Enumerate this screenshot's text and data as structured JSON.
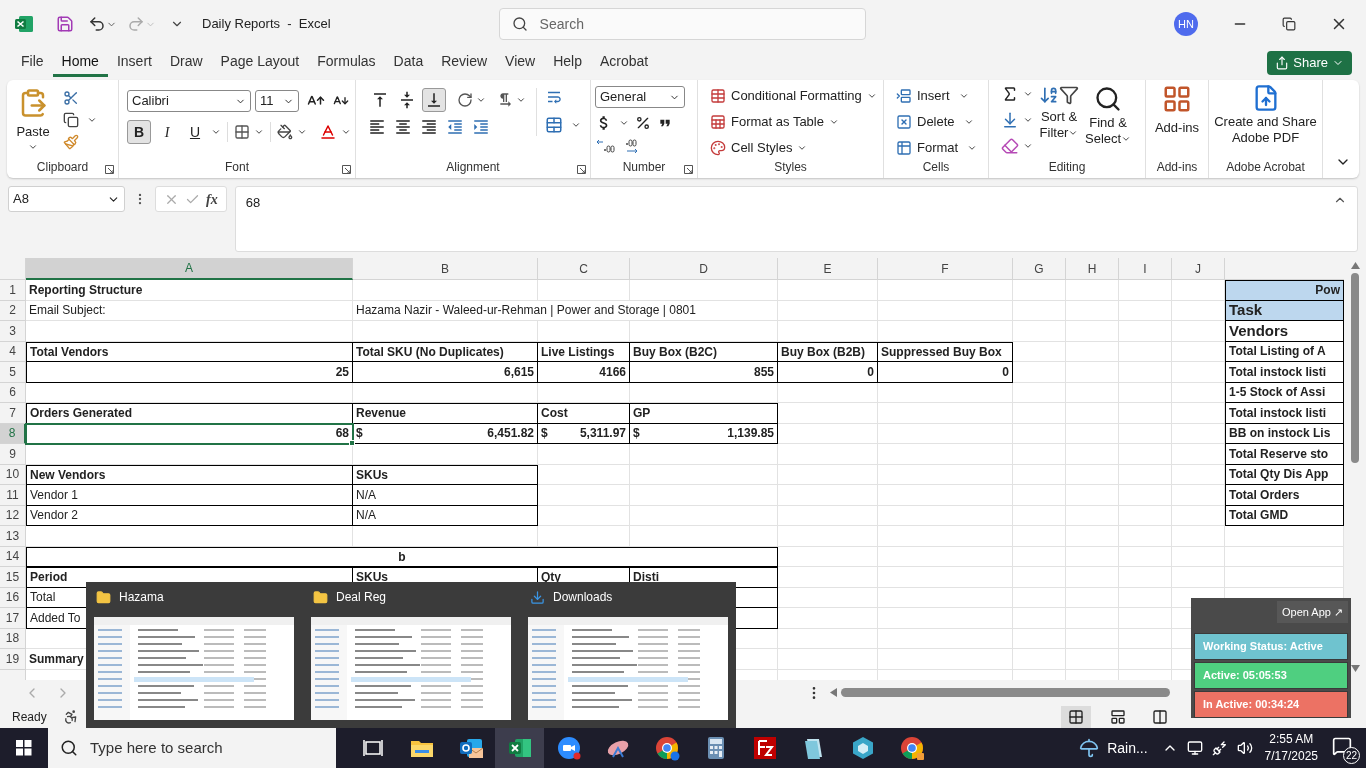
{
  "window": {
    "title": "Daily Reports  -  Excel",
    "search_placeholder": "Search",
    "user_initials": "HN"
  },
  "menu_tabs": [
    {
      "label": "File",
      "selected": false
    },
    {
      "label": "Home",
      "selected": true
    },
    {
      "label": "Insert",
      "selected": false
    },
    {
      "label": "Draw",
      "selected": false
    },
    {
      "label": "Page Layout",
      "selected": false
    },
    {
      "label": "Formulas",
      "selected": false
    },
    {
      "label": "Data",
      "selected": false
    },
    {
      "label": "Review",
      "selected": false
    },
    {
      "label": "View",
      "selected": false
    },
    {
      "label": "Help",
      "selected": false
    },
    {
      "label": "Acrobat",
      "selected": false
    }
  ],
  "share_button": "Share",
  "ribbon": {
    "clipboard": {
      "paste": "Paste",
      "label": "Clipboard"
    },
    "font": {
      "family": "Calibri",
      "size": "11",
      "styles": [
        {
          "label": "B",
          "pressed": true
        },
        {
          "label": "I",
          "pressed": false
        },
        {
          "label": "U",
          "pressed": false
        }
      ],
      "label": "Font"
    },
    "alignment": {
      "vertical": [
        {
          "kind": "top",
          "pressed": false
        },
        {
          "kind": "middle",
          "pressed": false
        },
        {
          "kind": "bottom",
          "pressed": true
        }
      ],
      "label": "Alignment"
    },
    "number": {
      "format": "General",
      "label": "Number"
    },
    "styles": {
      "items": [
        "Conditional Formatting",
        "Format as Table",
        "Cell Styles"
      ],
      "label": "Styles"
    },
    "cells": {
      "items": [
        "Insert",
        "Delete",
        "Format"
      ],
      "label": "Cells"
    },
    "editing": {
      "sort": [
        "Sort &",
        "Filter"
      ],
      "find": [
        "Find &",
        "Select"
      ],
      "label": "Editing"
    },
    "addins": {
      "button": "Add-ins",
      "label": "Add-ins"
    },
    "acrobat": {
      "button": [
        "Create and Share",
        "Adobe PDF"
      ],
      "label": "Adobe Acrobat"
    }
  },
  "formula_bar": {
    "name_box": "A8",
    "function_label": "fx",
    "value": "68"
  },
  "sheet": {
    "columns": [
      {
        "label": "A",
        "selected": true
      },
      {
        "label": "B",
        "selected": false
      },
      {
        "label": "C",
        "selected": false
      },
      {
        "label": "D",
        "selected": false
      },
      {
        "label": "E",
        "selected": false
      },
      {
        "label": "F",
        "selected": false
      },
      {
        "label": "G",
        "selected": false
      },
      {
        "label": "H",
        "selected": false
      },
      {
        "label": "I",
        "selected": false
      },
      {
        "label": "J",
        "selected": false
      }
    ],
    "rows": [
      {
        "number": "1",
        "selected": false,
        "cells": {
          "a": "Reporting Structure",
          "k": "Pow"
        }
      },
      {
        "number": "2",
        "selected": false,
        "cells": {
          "a": "Email Subject:",
          "b": "Hazama Nazir - Waleed-ur-Rehman | Power and Storage | 0801",
          "k": "Task"
        }
      },
      {
        "number": "3",
        "selected": false,
        "cells": {
          "k": "Vendors"
        }
      },
      {
        "number": "4",
        "selected": false,
        "cells": {
          "a": "Total Vendors",
          "b": "Total SKU (No Duplicates)",
          "c": "Live Listings",
          "d": "Buy Box (B2C)",
          "e": "Buy Box (B2B)",
          "f": "Suppressed Buy Box",
          "k": "Total Listing of A"
        }
      },
      {
        "number": "5",
        "selected": false,
        "cells": {
          "a": "25",
          "b": "6,615",
          "c": "4166",
          "d": "855",
          "e": "0",
          "f": "0",
          "k": "Total instock listi"
        }
      },
      {
        "number": "6",
        "selected": false,
        "cells": {
          "k": "1-5 Stock of Assi"
        }
      },
      {
        "number": "7",
        "selected": false,
        "cells": {
          "a": "Orders Generated",
          "b": "Revenue",
          "c": "Cost",
          "d": "GP",
          "k": "Total instock listi"
        }
      },
      {
        "number": "8",
        "selected": true,
        "cells": {
          "a": "68",
          "b": {
            "currency": "$",
            "text": "6,451.82"
          },
          "c": {
            "currency": "$",
            "text": "5,311.97"
          },
          "d": {
            "currency": "$",
            "text": "1,139.85"
          },
          "k": "BB on instock Lis"
        }
      },
      {
        "number": "9",
        "selected": false,
        "cells": {
          "k": "Total Reserve sto"
        }
      },
      {
        "number": "10",
        "selected": false,
        "cells": {
          "a": "New Vendors",
          "b": "SKUs",
          "k": "Total Qty Dis App"
        }
      },
      {
        "number": "11",
        "selected": false,
        "cells": {
          "a": "Vendor 1",
          "b": "N/A",
          "k": "Total Orders"
        }
      },
      {
        "number": "12",
        "selected": false,
        "cells": {
          "a": "Vendor 2",
          "b": "N/A",
          "k": "Total GMD"
        }
      },
      {
        "number": "13",
        "selected": false
      },
      {
        "number": "14",
        "selected": false,
        "cells": {
          "a": "b"
        }
      },
      {
        "number": "15",
        "selected": false,
        "cells": {
          "a": "Period",
          "b": "SKUs",
          "c": "Qty",
          "d": "Disti"
        }
      },
      {
        "number": "16",
        "selected": false,
        "cells": {
          "a": "Total"
        }
      },
      {
        "number": "17",
        "selected": false,
        "cells": {
          "a": "Added To"
        }
      },
      {
        "number": "18",
        "selected": false
      },
      {
        "number": "19",
        "selected": false,
        "cells": {
          "a": "Summary"
        }
      }
    ]
  },
  "status_bar": {
    "status": "Ready",
    "views": [
      {
        "kind": "normal",
        "selected": true
      },
      {
        "kind": "page_layout",
        "selected": false
      },
      {
        "kind": "page_break",
        "selected": false
      }
    ]
  },
  "window_previews": [
    {
      "kind": "folder",
      "title": "Hazama"
    },
    {
      "kind": "folder",
      "title": "Deal Reg"
    },
    {
      "kind": "downloads",
      "title": "Downloads"
    }
  ],
  "time_tracker": {
    "open_app": "Open App ↗",
    "statuses": [
      {
        "text": "Working Status: Active",
        "color": "#6fc3cf"
      },
      {
        "text": "Active: 05:05:53",
        "color": "#4fcf80"
      },
      {
        "text": "In Active: 00:34:24",
        "color": "#ec7264"
      }
    ]
  },
  "taskbar": {
    "search_placeholder": "Type here to search",
    "apps": [
      {
        "kind": "task_view",
        "active": false
      },
      {
        "kind": "explorer",
        "active": false
      },
      {
        "kind": "outlook",
        "active": false
      },
      {
        "kind": "excel",
        "active": true
      },
      {
        "kind": "zoom",
        "active": false
      },
      {
        "kind": "satellite",
        "active": false
      },
      {
        "kind": "chrome_profile",
        "active": false
      },
      {
        "kind": "calculator",
        "active": false
      },
      {
        "kind": "filezilla",
        "active": false
      },
      {
        "kind": "notes",
        "active": false
      },
      {
        "kind": "hexagon",
        "active": false
      },
      {
        "kind": "chrome",
        "active": false
      }
    ],
    "weather": "Rain...",
    "time": "2:55 AM",
    "date": "7/17/2025",
    "notifications": "22"
  }
}
